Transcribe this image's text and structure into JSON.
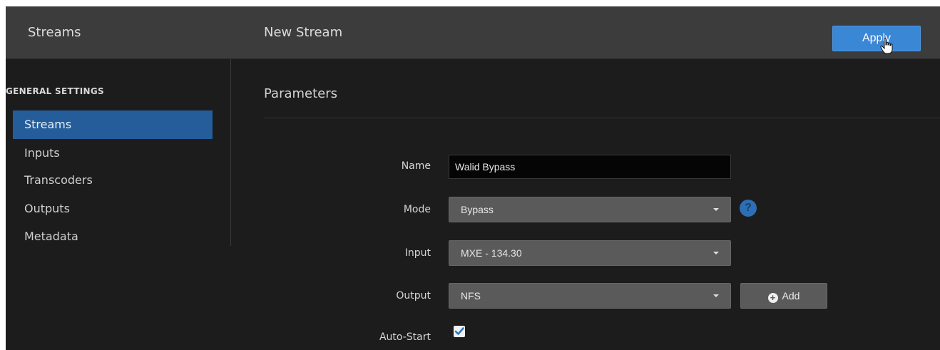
{
  "header": {
    "section_title": "Streams",
    "page_title": "New Stream",
    "apply_label": "Apply"
  },
  "sidebar": {
    "heading": "GENERAL SETTINGS",
    "items": [
      {
        "label": "Streams",
        "active": true
      },
      {
        "label": "Inputs"
      },
      {
        "label": "Transcoders"
      },
      {
        "label": "Outputs"
      },
      {
        "label": "Metadata"
      }
    ]
  },
  "main": {
    "section_title": "Parameters",
    "fields": {
      "name": {
        "label": "Name",
        "value": "Walid Bypass"
      },
      "mode": {
        "label": "Mode",
        "value": "Bypass",
        "help_icon": "?"
      },
      "input": {
        "label": "Input",
        "value": "MXE - 134.30"
      },
      "output": {
        "label": "Output",
        "value": "NFS",
        "add_label": "Add"
      },
      "auto_start": {
        "label": "Auto-Start",
        "checked": true
      }
    }
  },
  "icons": {
    "help": "question-circle-icon",
    "add": "plus-circle-icon",
    "caret": "chevron-down-icon",
    "check": "checkmark-icon",
    "cursor": "hand-pointer-icon"
  },
  "colors": {
    "accent": "#3a87d6",
    "active_nav": "#245d9a",
    "header_bg": "#3c3c3c",
    "page_bg": "#1c1c1c"
  }
}
